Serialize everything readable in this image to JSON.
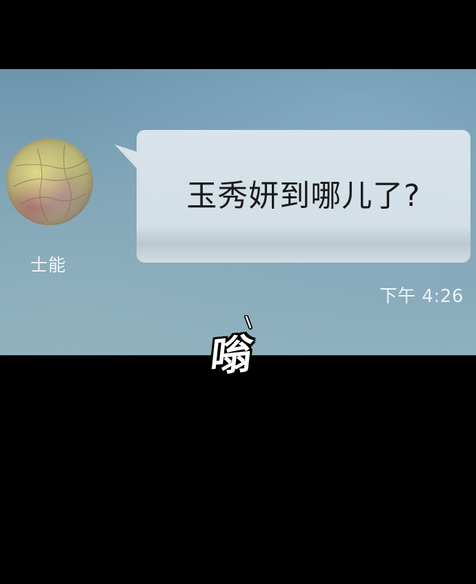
{
  "chat": {
    "sender_name": "士能",
    "message": "玉秀妍到哪儿了?",
    "timestamp": "下午 4:26"
  },
  "sound_effect": {
    "text": "嗡"
  },
  "colors": {
    "background": "#000000",
    "screen": "#7fa3b6",
    "bubble": "#d6e1e8",
    "message_text": "#1a1a1a",
    "meta_text": "#eef3f6"
  },
  "icons": {
    "avatar": "profile-photo"
  }
}
